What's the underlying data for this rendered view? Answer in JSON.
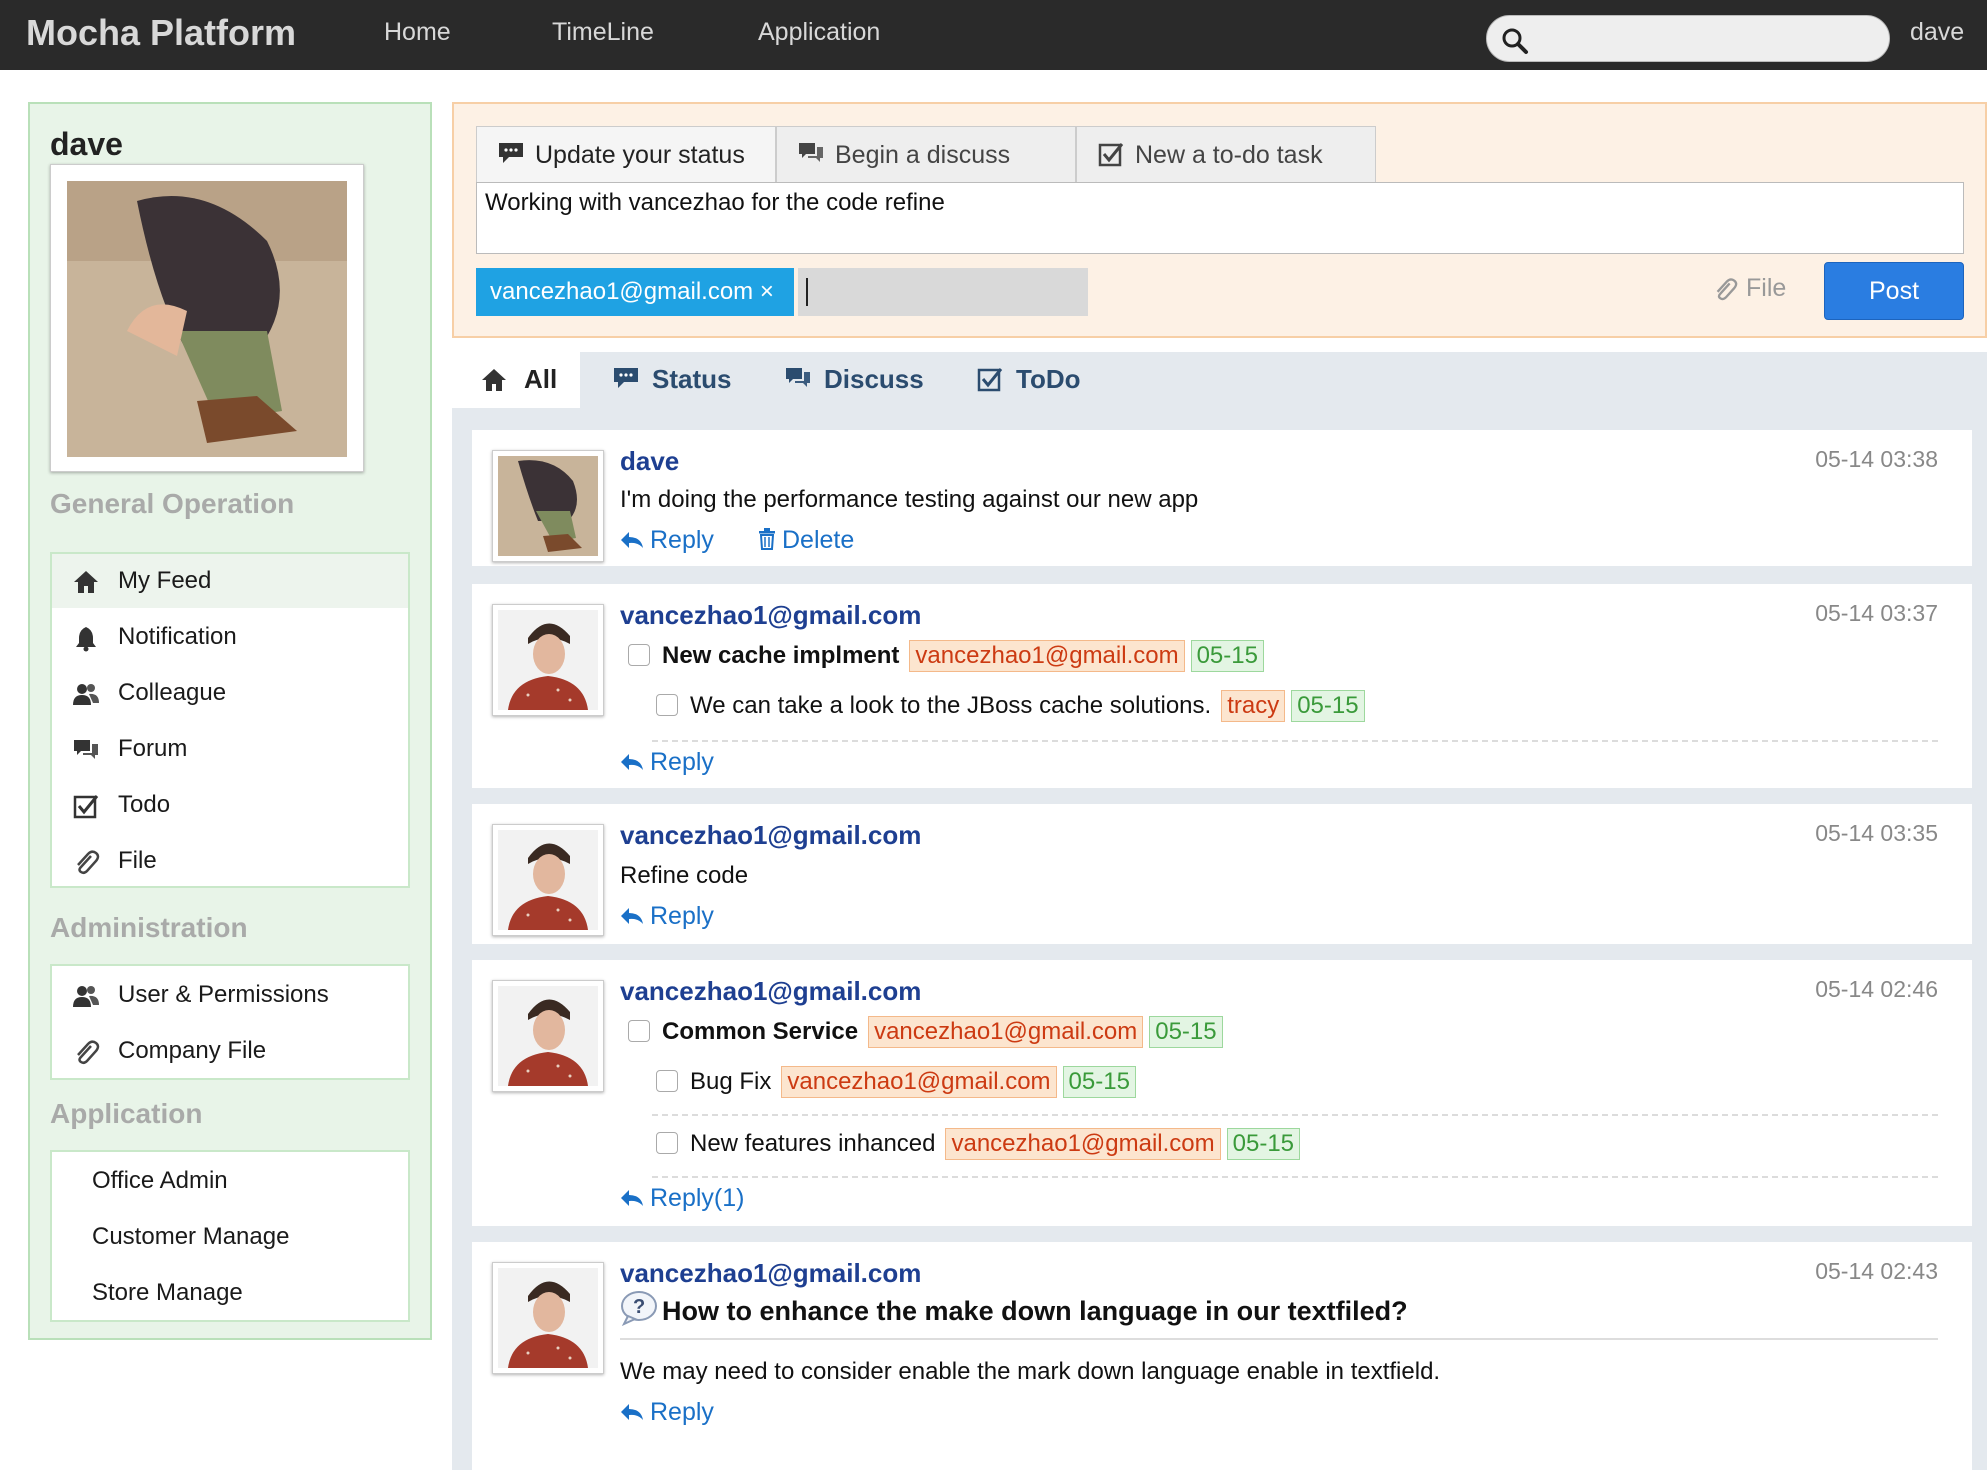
{
  "navbar": {
    "brand": "Mocha Platform",
    "links": [
      "Home",
      "TimeLine",
      "Application"
    ],
    "search_placeholder": "",
    "user": "dave"
  },
  "sidebar": {
    "name": "dave",
    "sections": {
      "general": {
        "title": "General Operation",
        "items": [
          "My Feed",
          "Notification",
          "Colleague",
          "Forum",
          "Todo",
          "File"
        ]
      },
      "admin": {
        "title": "Administration",
        "items": [
          "User & Permissions",
          "Company File"
        ]
      },
      "application": {
        "title": "Application",
        "items": [
          "Office Admin",
          "Customer Manage",
          "Store Manage"
        ]
      }
    }
  },
  "composer": {
    "tabs": [
      "Update your status",
      "Begin a discuss",
      "New a to-do task"
    ],
    "text": "Working with vancezhao for the code refine",
    "tag": "vancezhao1@gmail.com ×",
    "file_label": "File",
    "post_label": "Post"
  },
  "feed_tabs": [
    "All",
    "Status",
    "Discuss",
    "ToDo"
  ],
  "posts": [
    {
      "author": "dave",
      "time": "05-14 03:38",
      "text": "I'm doing the performance testing against our new app",
      "reply": "Reply",
      "delete": "Delete"
    },
    {
      "author": "vancezhao1@gmail.com",
      "time": "05-14 03:37",
      "todo_main": {
        "title": "New cache implment",
        "user": "vancezhao1@gmail.com",
        "date": "05-15"
      },
      "todo_sub": [
        {
          "title": "We can take a look to the JBoss cache solutions.",
          "user": "tracy",
          "date": "05-15"
        }
      ],
      "reply": "Reply"
    },
    {
      "author": "vancezhao1@gmail.com",
      "time": "05-14 03:35",
      "text": "Refine code",
      "reply": "Reply"
    },
    {
      "author": "vancezhao1@gmail.com",
      "time": "05-14 02:46",
      "todo_main": {
        "title": "Common Service",
        "user": "vancezhao1@gmail.com",
        "date": "05-15"
      },
      "todo_sub": [
        {
          "title": "Bug Fix",
          "user": "vancezhao1@gmail.com",
          "date": "05-15"
        },
        {
          "title": "New features inhanced",
          "user": "vancezhao1@gmail.com",
          "date": "05-15"
        }
      ],
      "reply": "Reply(1)"
    },
    {
      "author": "vancezhao1@gmail.com",
      "time": "05-14 02:43",
      "question": "How to enhance the make down language in our textfiled?",
      "text": "We may need to consider enable the mark down language enable in textfield.",
      "reply": "Reply"
    }
  ],
  "colors": {
    "navbar_bg": "#2a2a2a",
    "link_blue": "#1a70c7",
    "author_blue": "#1e3f91",
    "post_button": "#2a7de1",
    "tag_token": "#1fa2e3",
    "badge_user": "#cc3a12",
    "badge_date": "#3a9a3a"
  },
  "icons": {
    "search": "search-icon",
    "home": "home-icon",
    "bell": "bell-icon",
    "users": "users-icon",
    "chat": "chat-icon",
    "check": "checkbox-icon",
    "paperclip": "paperclip-icon",
    "reply": "reply-arrow-icon",
    "trash": "trash-icon",
    "question": "question-bubble-icon"
  }
}
